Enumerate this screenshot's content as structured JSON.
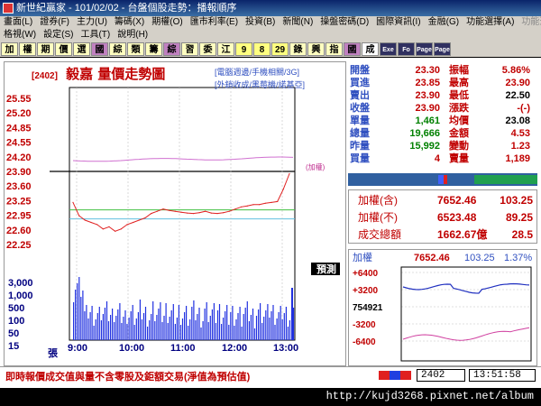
{
  "window": {
    "title": "新世紀贏家 - 101/02/02 - 台盤個股走勢：播報順序"
  },
  "menu_row1": [
    {
      "label": "畫面(L)",
      "enabled": true
    },
    {
      "label": "證券(F)",
      "enabled": true
    },
    {
      "label": "主力(U)",
      "enabled": true
    },
    {
      "label": "籌碼(X)",
      "enabled": true
    },
    {
      "label": "期權(O)",
      "enabled": true
    },
    {
      "label": "匯市利率(E)",
      "enabled": true
    },
    {
      "label": "投資(B)",
      "enabled": true
    },
    {
      "label": "新聞(N)",
      "enabled": true
    },
    {
      "label": "操盤密碼(D)",
      "enabled": true
    },
    {
      "label": "國際資訊(I)",
      "enabled": true
    },
    {
      "label": "金融(G)",
      "enabled": true
    },
    {
      "label": "功能選擇(A)",
      "enabled": true
    },
    {
      "label": "功能選擇(B)",
      "enabled": false
    }
  ],
  "menu_row2": [
    {
      "label": "格視(W)",
      "enabled": true
    },
    {
      "label": "設定(S)",
      "enabled": true
    },
    {
      "label": "工具(T)",
      "enabled": true
    },
    {
      "label": "說明(H)",
      "enabled": true
    }
  ],
  "toolbar": [
    {
      "label": "加",
      "style": "n"
    },
    {
      "label": "權",
      "style": "n"
    },
    {
      "label": "期",
      "style": "n"
    },
    {
      "label": "價",
      "style": "n"
    },
    {
      "label": "選",
      "style": "n"
    },
    {
      "label": "國",
      "style": "p"
    },
    {
      "label": "綜",
      "style": "n"
    },
    {
      "label": "類",
      "style": "n"
    },
    {
      "label": "籌",
      "style": "n"
    },
    {
      "label": "綜",
      "style": "p"
    },
    {
      "label": "習",
      "style": "n"
    },
    {
      "label": "委",
      "style": "n"
    },
    {
      "label": "江",
      "style": "n"
    },
    {
      "label": "9",
      "style": "h"
    },
    {
      "label": "8",
      "style": "h"
    },
    {
      "label": "29",
      "style": "h"
    },
    {
      "label": "錄",
      "style": "n"
    },
    {
      "label": "興",
      "style": "n"
    },
    {
      "label": "指",
      "style": "n"
    },
    {
      "label": "國",
      "style": "p"
    },
    {
      "label": "成",
      "style": "g"
    },
    {
      "label": "Exe",
      "style": "d"
    },
    {
      "label": "Fo",
      "style": "d"
    },
    {
      "label": "Page",
      "style": "d"
    },
    {
      "label": "Page",
      "style": "d"
    }
  ],
  "chart": {
    "stock_code": "[2402]",
    "title": "毅嘉  量價走勢圖",
    "links_line1": "[電腦週邊/手機相關/3G]",
    "links_line2": "[外銷收成/黑莓機/諾基亞]",
    "ref_tag": "(加權)",
    "volume_label_unit": "張",
    "price_ticks": [
      "25.55",
      "25.20",
      "24.85",
      "24.55",
      "24.20",
      "23.90",
      "23.60",
      "23.25",
      "22.95",
      "22.60",
      "22.25"
    ],
    "volume_ticks": [
      "3,000",
      "1,000",
      "500",
      "100",
      "50",
      "15"
    ],
    "time_ticks": [
      "9:00",
      "10:00",
      "11:00",
      "12:00",
      "13:00"
    ],
    "note_tag": "預測"
  },
  "chart_data": {
    "type": "line",
    "xlabel": "",
    "ylabel": "",
    "price_series": [
      23.2,
      22.9,
      22.8,
      22.75,
      22.7,
      22.6,
      22.65,
      22.55,
      22.6,
      22.7,
      22.75,
      22.8,
      22.85,
      22.95,
      23.0,
      23.05,
      23.02,
      23.0,
      22.98,
      22.96,
      22.95,
      22.97,
      23.0,
      22.96,
      22.95,
      22.97,
      23.0,
      23.05,
      23.1,
      23.12,
      23.15,
      23.15,
      23.18,
      23.2,
      23.22,
      23.5,
      23.85
    ],
    "time_axis": [
      "9:00",
      "10:00",
      "11:00",
      "12:00",
      "13:00"
    ],
    "ylim": [
      22.25,
      25.55
    ],
    "reference_price": 23.9
  },
  "quote": {
    "rows": [
      {
        "l1": "開盤",
        "v1": "23.30",
        "l2": "振幅",
        "v2": "5.86%"
      },
      {
        "l1": "買進",
        "v1": "23.85",
        "l2": "最高",
        "v2": "23.90"
      },
      {
        "l1": "賣出",
        "v1": "23.90",
        "l2": "最低",
        "v2": "22.50"
      },
      {
        "l1": "收盤",
        "v1": "23.90",
        "l2": "漲跌",
        "v2": "-(-)"
      },
      {
        "l1": "單量",
        "v1": "1,461",
        "l2": "均價",
        "v2": "23.08"
      },
      {
        "l1": "總量",
        "v1": "19,666",
        "l2": "金額",
        "v2": "4.53"
      },
      {
        "l1": "昨量",
        "v1": "15,992",
        "l2": "變動",
        "v2": "1.23"
      },
      {
        "l1": "買量",
        "v1": "4",
        "l2": "賣量",
        "v2": "1,189"
      }
    ]
  },
  "index": {
    "rows": [
      {
        "label": "加權(含)",
        "value": "7652.46",
        "change": "103.25"
      },
      {
        "label": "加權(不)",
        "value": "6523.48",
        "change": "89.25"
      },
      {
        "label": "成交總額",
        "value": "1662.67億",
        "change": "28.5"
      }
    ]
  },
  "mini": {
    "label": "加權",
    "value": "7652.46",
    "change": "103.25",
    "pct": "1.37%",
    "ticks": [
      "+6400",
      "+3200",
      "754921",
      "-3200",
      "-6400"
    ]
  },
  "status": {
    "note": "即時報價成交值與量不含零股及鉅額交易(淨值為預估值)",
    "code": "2402",
    "time": "13:51:58"
  },
  "watermark": "http://kujd3268.pixnet.net/album"
}
